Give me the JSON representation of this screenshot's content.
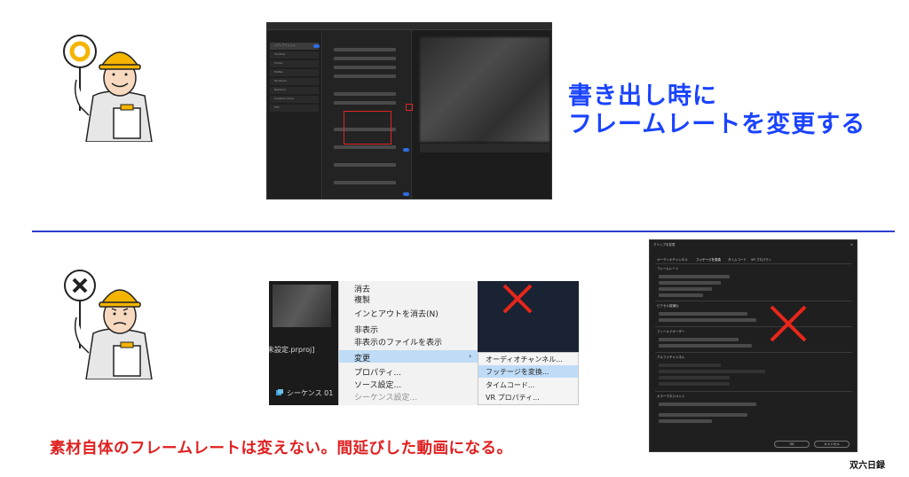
{
  "title_lines": [
    "書き出し時に",
    "フレームレートを変更する"
  ],
  "warning_text": "素材自体のフレームレートは変えない。間延びした動画になる。",
  "brand": "双六日録",
  "good_sign_symbol": "○",
  "bad_sign_symbol": "×",
  "colors": {
    "title": "#1a43ff",
    "warning": "#e02020",
    "divider": "#2f3fd1",
    "cross": "#e8261a",
    "helmet": "#f4b400"
  },
  "context_menu": {
    "items": [
      "消去",
      "複製",
      "インとアウトを消去(N)",
      "非表示",
      "非表示のファイルを表示",
      "変更",
      "プロパティ...",
      "ソース設定...",
      "シーケンス設定..."
    ],
    "highlighted": "変更",
    "submenu": [
      "オーディオチャンネル...",
      "フッテージを変換...",
      "タイムコード...",
      "VR プロパティ..."
    ],
    "submenu_highlighted": "フッテージを変換..."
  },
  "project_panel": {
    "file_label": "未設定.prproj]",
    "sequence_label": "シーケンス 01"
  },
  "dialog": {
    "title": "クリップを変更",
    "tabs": [
      "オーディオチャンネル",
      "フッテージを変換",
      "タイムコード",
      "VR プロパティ"
    ],
    "active_tab": "フッテージを変換",
    "sections": [
      "フレームレート",
      "ピクセル縦横比",
      "フィールドオーダー",
      "アルファチャンネル",
      "カラーマネジメント"
    ],
    "buttons": [
      "OK",
      "キャンセル"
    ]
  },
  "export_screen": {
    "sidebar_items": [
      "メディアファイル",
      "YouTube",
      "Vimeo",
      "Twitter",
      "Facebook",
      "Behance",
      "Creative Cloud",
      "FTP"
    ]
  },
  "icons": [
    "helmet-worker-good-icon",
    "helmet-worker-bad-icon",
    "red-cross-icon",
    "sequence-icon"
  ]
}
